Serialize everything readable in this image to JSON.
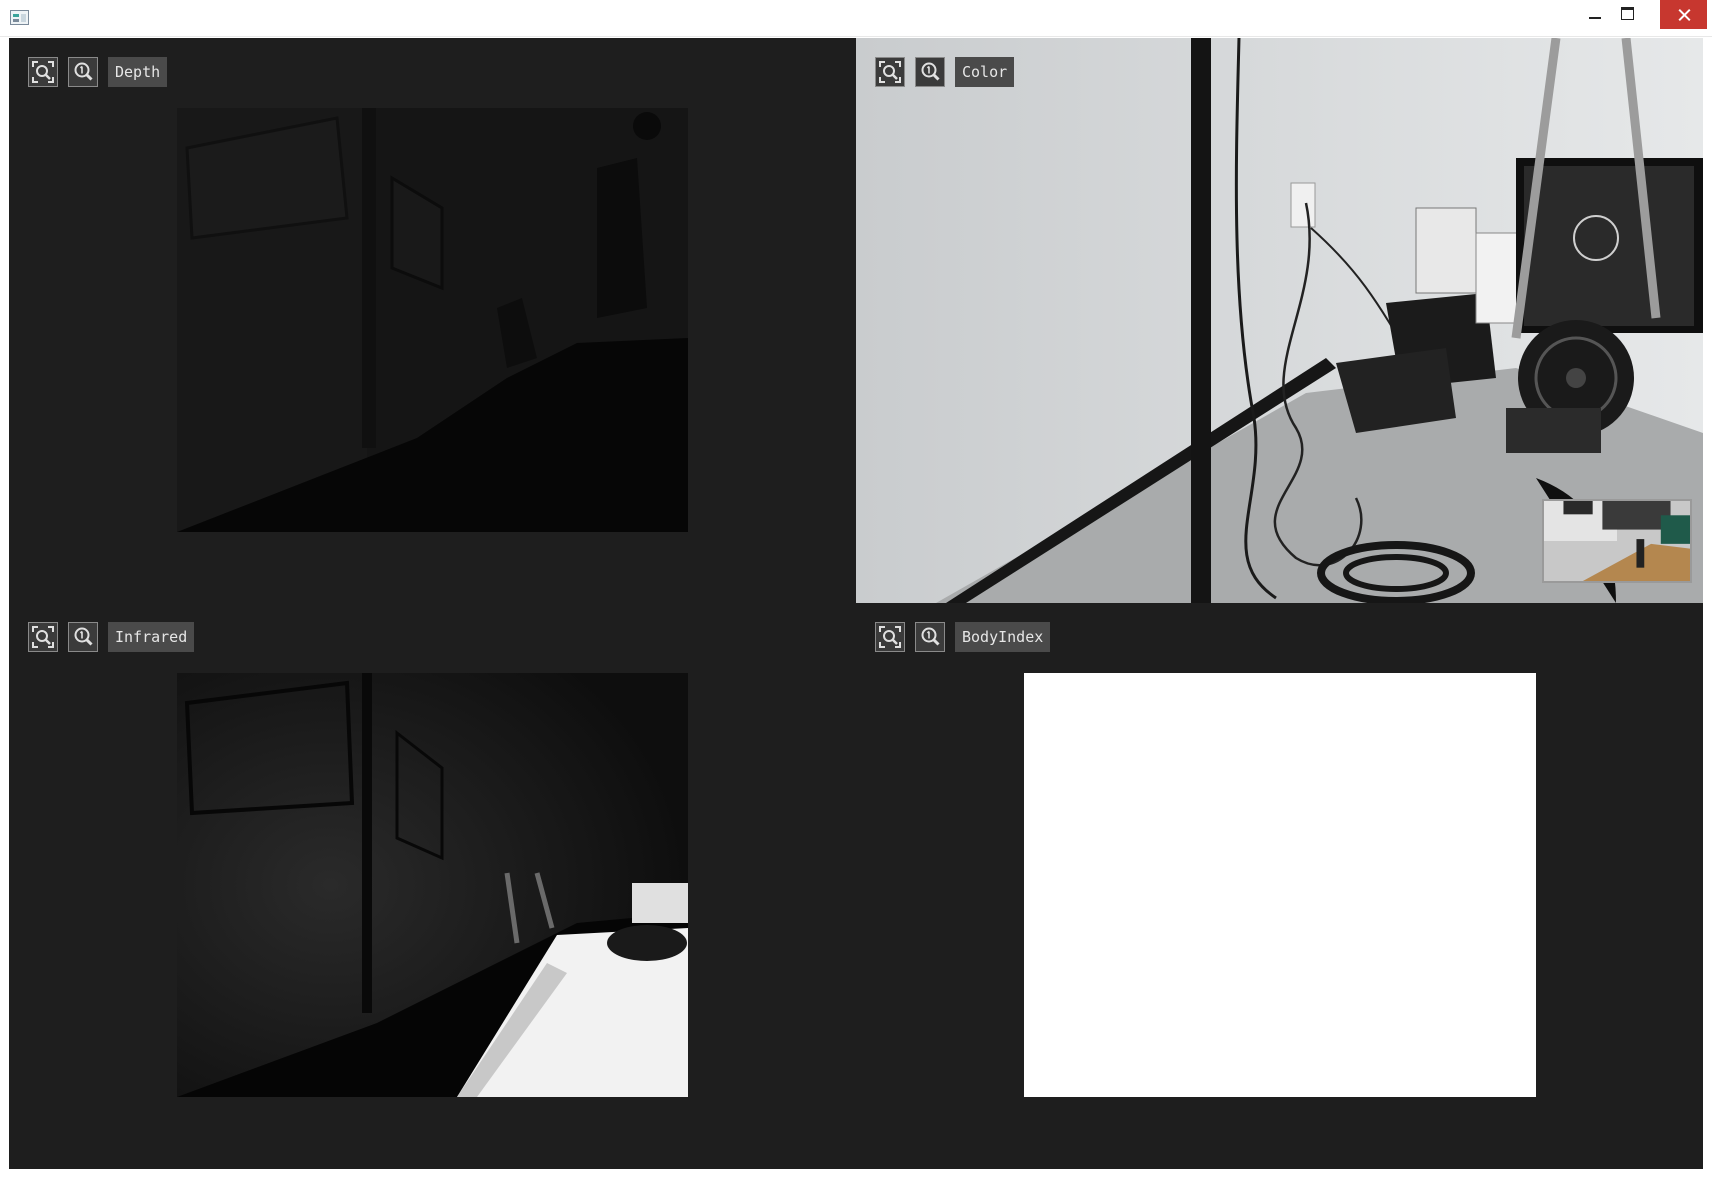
{
  "window": {
    "title": "",
    "icon": "app-window-icon"
  },
  "panels": {
    "depth": {
      "label": "Depth",
      "fit_icon": "fit-to-view-icon",
      "zoom_icon": "actual-size-zoom-icon"
    },
    "color": {
      "label": "Color",
      "fit_icon": "fit-to-view-icon",
      "zoom_icon": "actual-size-zoom-icon"
    },
    "infrared": {
      "label": "Infrared",
      "fit_icon": "fit-to-view-icon",
      "zoom_icon": "actual-size-zoom-icon"
    },
    "bodyindex": {
      "label": "BodyIndex",
      "fit_icon": "fit-to-view-icon",
      "zoom_icon": "actual-size-zoom-icon"
    }
  },
  "colors": {
    "client_background": "#1e1e1e",
    "label_background": "#4a4a4a",
    "close_button": "#c7372f",
    "bodyindex_frame": "#ffffff"
  }
}
